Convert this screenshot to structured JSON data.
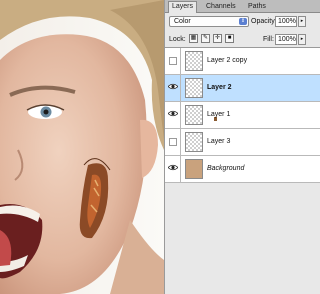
{
  "panel": {
    "tabs": [
      {
        "label": "Layers"
      },
      {
        "label": "Channels"
      },
      {
        "label": "Paths"
      }
    ],
    "blend_mode": "Color",
    "opacity_label": "Opacity:",
    "opacity_value": "100%",
    "lock_label": "Lock:",
    "fill_label": "Fill:",
    "fill_value": "100%",
    "layers": [
      {
        "name": "Layer 2 copy",
        "visible": false,
        "selected": false
      },
      {
        "name": "Layer 2",
        "visible": true,
        "selected": true
      },
      {
        "name": "Layer 1",
        "visible": true,
        "selected": false
      },
      {
        "name": "Layer 3",
        "visible": false,
        "selected": false
      },
      {
        "name": "Background",
        "visible": true,
        "selected": false
      }
    ]
  },
  "icons": {
    "eye": "eye-icon",
    "lock_transparent": "lock-transparent-icon",
    "lock_paint": "brush-icon",
    "lock_move": "move-icon",
    "lock_all": "lock-icon"
  },
  "colors": {
    "selected_row": "#bfe0ff",
    "panel_bg": "#e8e8e8"
  }
}
